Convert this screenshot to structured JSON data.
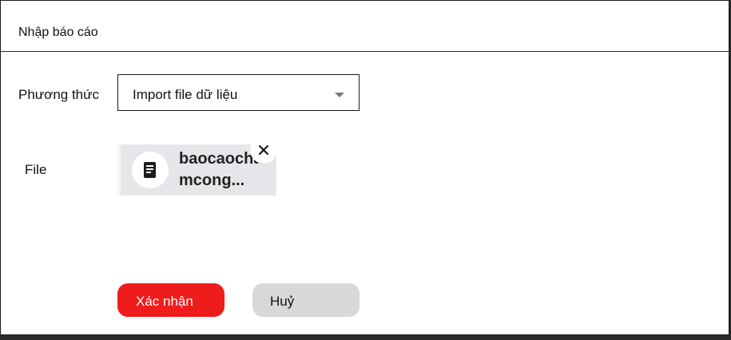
{
  "dialog": {
    "title": "Nhập báo cáo"
  },
  "form": {
    "method_label": "Phương thức",
    "method_selected": "Import file dữ liệu",
    "file_label": "File",
    "file_name": "baocaochamcong...",
    "file_icon": "document-icon",
    "remove_icon": "close-icon"
  },
  "actions": {
    "confirm_label": "Xác nhận",
    "cancel_label": "Huỷ"
  },
  "colors": {
    "confirm": "#ef1c1c",
    "cancel": "#d8d8d8",
    "chip": "#e6e6ea"
  }
}
